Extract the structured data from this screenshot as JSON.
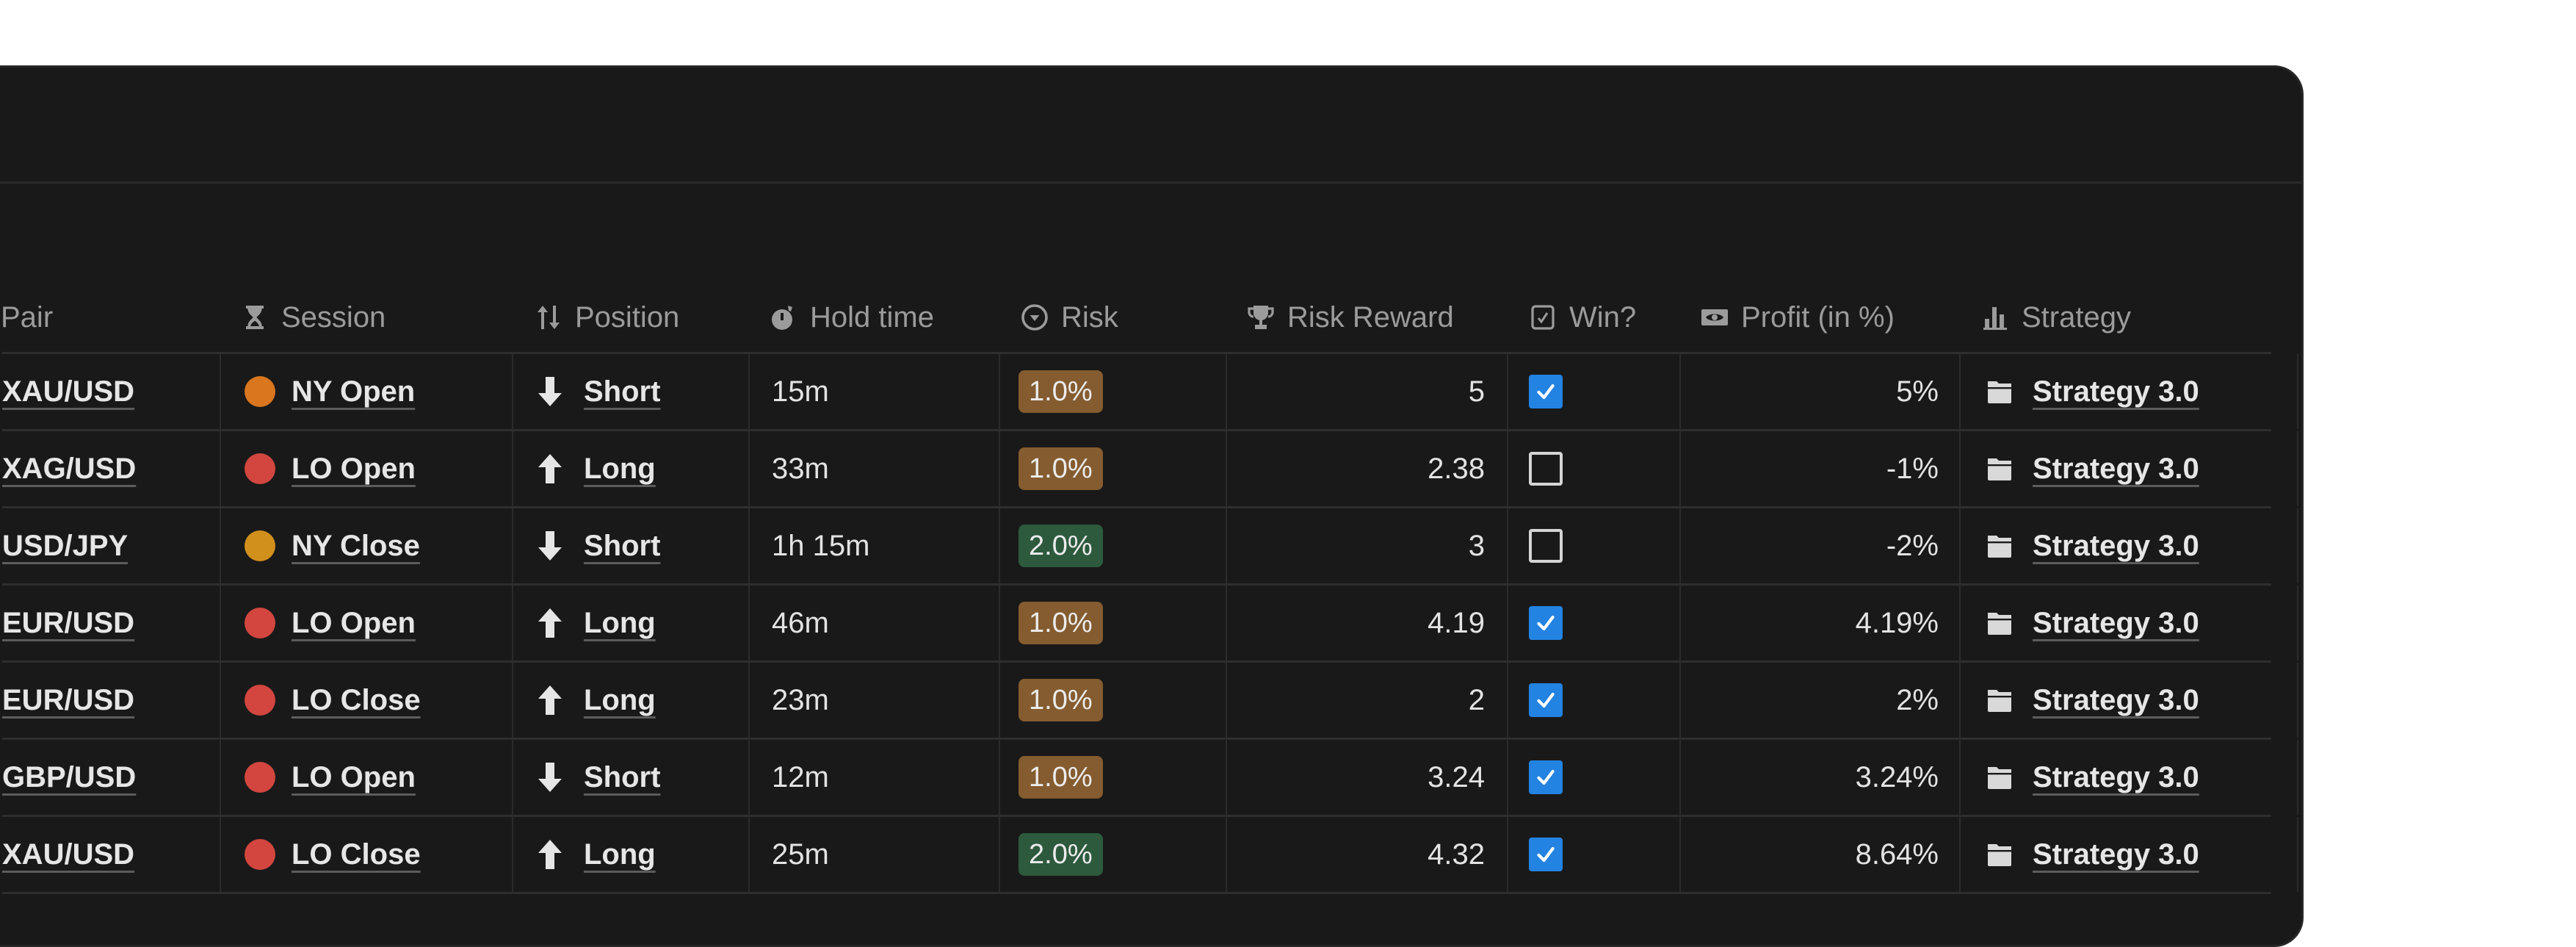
{
  "columns": [
    {
      "key": "pair",
      "label": "Pair",
      "icon": "text-icon"
    },
    {
      "key": "session",
      "label": "Session",
      "icon": "hourglass-icon"
    },
    {
      "key": "position",
      "label": "Position",
      "icon": "sort-arrows-icon"
    },
    {
      "key": "hold_time",
      "label": "Hold time",
      "icon": "stopwatch-icon"
    },
    {
      "key": "risk",
      "label": "Risk",
      "icon": "select-circle-icon"
    },
    {
      "key": "risk_reward",
      "label": "Risk Reward",
      "icon": "trophy-icon"
    },
    {
      "key": "win",
      "label": "Win?",
      "icon": "checkbox-icon"
    },
    {
      "key": "profit",
      "label": "Profit (in %)",
      "icon": "banknote-icon"
    },
    {
      "key": "strategy",
      "label": "Strategy",
      "icon": "bar-chart-icon"
    }
  ],
  "colors": {
    "panel_bg": "#191919",
    "session_ny_open": "#D9761E",
    "session_ny_close": "#D1901C",
    "session_lo": "#D2463F",
    "risk_1": "#845C30",
    "risk_2": "#2D5A3D",
    "checkbox_checked": "#2383E2"
  },
  "rows": [
    {
      "pair": "XAU/USD",
      "session": "NY Open",
      "session_color": "#D9761E",
      "position": "Short",
      "direction": "down",
      "hold_time": "15m",
      "risk": "1.0%",
      "risk_color": "#845C30",
      "risk_reward": "5",
      "win": true,
      "profit": "5%",
      "strategy": "Strategy 3.0"
    },
    {
      "pair": "XAG/USD",
      "session": "LO Open",
      "session_color": "#D2463F",
      "position": "Long",
      "direction": "up",
      "hold_time": "33m",
      "risk": "1.0%",
      "risk_color": "#845C30",
      "risk_reward": "2.38",
      "win": false,
      "profit": "-1%",
      "strategy": "Strategy 3.0"
    },
    {
      "pair": "USD/JPY",
      "session": "NY Close",
      "session_color": "#D1901C",
      "position": "Short",
      "direction": "down",
      "hold_time": "1h 15m",
      "risk": "2.0%",
      "risk_color": "#2D5A3D",
      "risk_reward": "3",
      "win": false,
      "profit": "-2%",
      "strategy": "Strategy 3.0"
    },
    {
      "pair": "EUR/USD",
      "session": "LO Open",
      "session_color": "#D2463F",
      "position": "Long",
      "direction": "up",
      "hold_time": "46m",
      "risk": "1.0%",
      "risk_color": "#845C30",
      "risk_reward": "4.19",
      "win": true,
      "profit": "4.19%",
      "strategy": "Strategy 3.0"
    },
    {
      "pair": "EUR/USD",
      "session": "LO Close",
      "session_color": "#D2463F",
      "position": "Long",
      "direction": "up",
      "hold_time": "23m",
      "risk": "1.0%",
      "risk_color": "#845C30",
      "risk_reward": "2",
      "win": true,
      "profit": "2%",
      "strategy": "Strategy 3.0"
    },
    {
      "pair": "GBP/USD",
      "session": "LO Open",
      "session_color": "#D2463F",
      "position": "Short",
      "direction": "down",
      "hold_time": "12m",
      "risk": "1.0%",
      "risk_color": "#845C30",
      "risk_reward": "3.24",
      "win": true,
      "profit": "3.24%",
      "strategy": "Strategy 3.0"
    },
    {
      "pair": "XAU/USD",
      "session": "LO Close",
      "session_color": "#D2463F",
      "position": "Long",
      "direction": "up",
      "hold_time": "25m",
      "risk": "2.0%",
      "risk_color": "#2D5A3D",
      "risk_reward": "4.32",
      "win": true,
      "profit": "8.64%",
      "strategy": "Strategy 3.0"
    }
  ]
}
